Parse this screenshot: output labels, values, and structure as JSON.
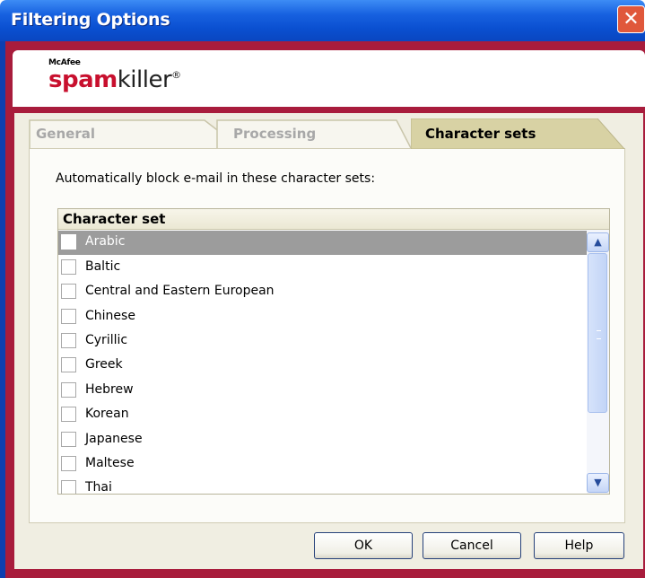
{
  "window": {
    "title": "Filtering Options",
    "close_glyph": "✕"
  },
  "logo": {
    "vendor": "McAfee",
    "product_prefix": "spam",
    "product_suffix": "killer",
    "reg_mark": "®"
  },
  "tabs": [
    {
      "label": "General",
      "active": false
    },
    {
      "label": "Processing",
      "active": false
    },
    {
      "label": "Character sets",
      "active": true
    }
  ],
  "instruction": "Automatically block e-mail in these character sets:",
  "list": {
    "header": "Character set",
    "items": [
      {
        "label": "Arabic",
        "checked": false,
        "selected": true
      },
      {
        "label": "Baltic",
        "checked": false,
        "selected": false
      },
      {
        "label": "Central and Eastern European",
        "checked": false,
        "selected": false
      },
      {
        "label": "Chinese",
        "checked": false,
        "selected": false
      },
      {
        "label": "Cyrillic",
        "checked": false,
        "selected": false
      },
      {
        "label": "Greek",
        "checked": false,
        "selected": false
      },
      {
        "label": "Hebrew",
        "checked": false,
        "selected": false
      },
      {
        "label": "Korean",
        "checked": false,
        "selected": false
      },
      {
        "label": "Japanese",
        "checked": false,
        "selected": false
      },
      {
        "label": "Maltese",
        "checked": false,
        "selected": false
      },
      {
        "label": "Thai",
        "checked": false,
        "selected": false
      }
    ]
  },
  "scrollbar": {
    "up_glyph": "▲",
    "down_glyph": "▼"
  },
  "buttons": {
    "ok": "OK",
    "cancel": "Cancel",
    "help": "Help"
  },
  "colors": {
    "titlebar": "#0a4fd0",
    "frame": "#a81c3c",
    "tab_active": "#d8d2a4",
    "selection": "#9c9c9c"
  }
}
